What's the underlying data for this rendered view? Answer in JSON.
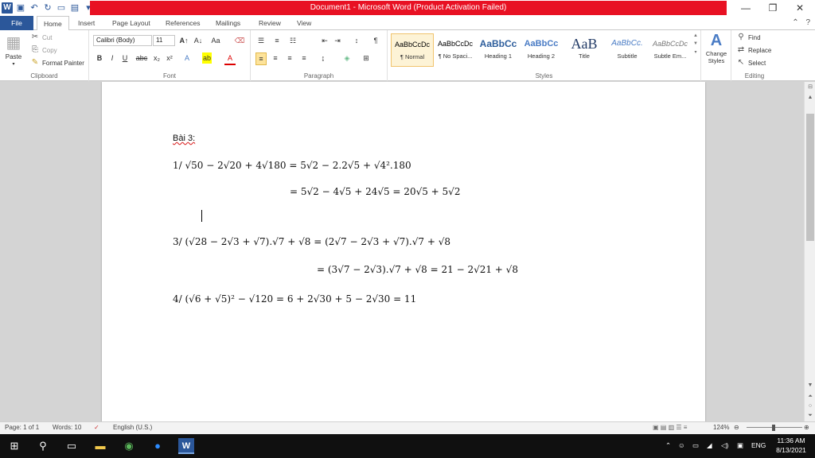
{
  "window": {
    "title": "Document1 - Microsoft Word (Product Activation Failed)",
    "controls": {
      "minimize": "—",
      "restore": "❐",
      "close": "✕"
    }
  },
  "tabs": [
    "File",
    "Home",
    "Insert",
    "Page Layout",
    "References",
    "Mailings",
    "Review",
    "View"
  ],
  "clipboard": {
    "paste": "Paste",
    "cut": "Cut",
    "copy": "Copy",
    "format_painter": "Format Painter",
    "label": "Clipboard"
  },
  "font": {
    "name": "Calibri (Body)",
    "size": "11",
    "label": "Font"
  },
  "paragraph": {
    "label": "Paragraph"
  },
  "styles": {
    "label": "Styles",
    "items": [
      {
        "sample": "AaBbCcDc",
        "name": "¶ Normal"
      },
      {
        "sample": "AaBbCcDc",
        "name": "¶ No Spaci..."
      },
      {
        "sample": "AaBbCc",
        "name": "Heading 1"
      },
      {
        "sample": "AaBbCc",
        "name": "Heading 2"
      },
      {
        "sample": "AaB",
        "name": "Title"
      },
      {
        "sample": "AaBbCc.",
        "name": "Subtitle"
      },
      {
        "sample": "AaBbCcDc",
        "name": "Subtle Em..."
      }
    ],
    "change_styles": "Change Styles"
  },
  "editing": {
    "find": "Find",
    "replace": "Replace",
    "select": "Select",
    "label": "Editing"
  },
  "document": {
    "heading": "Bài 3:",
    "line1": "1/ √50 − 2√20 + 4√180 = 5√2 − 2.2√5 + √4².180",
    "line2": "= 5√2 − 4√5 + 24√5 = 20√5 + 5√2",
    "line3": "3/ (√28 − 2√3 + √7).√7 + √8 = (2√7 − 2√3 + √7).√7 + √8",
    "line4": "= (3√7 − 2√3).√7 + √8 = 21 − 2√21 + √8",
    "line5": "4/ (√6 + √5)² − √120 = 6 + 2√30 + 5 − 2√30 = 11"
  },
  "status": {
    "page": "Page: 1 of 1",
    "words": "Words: 10",
    "language": "English (U.S.)",
    "zoom": "124%"
  },
  "taskbar": {
    "lang": "ENG",
    "time": "11:36 AM",
    "date": "8/13/2021"
  }
}
